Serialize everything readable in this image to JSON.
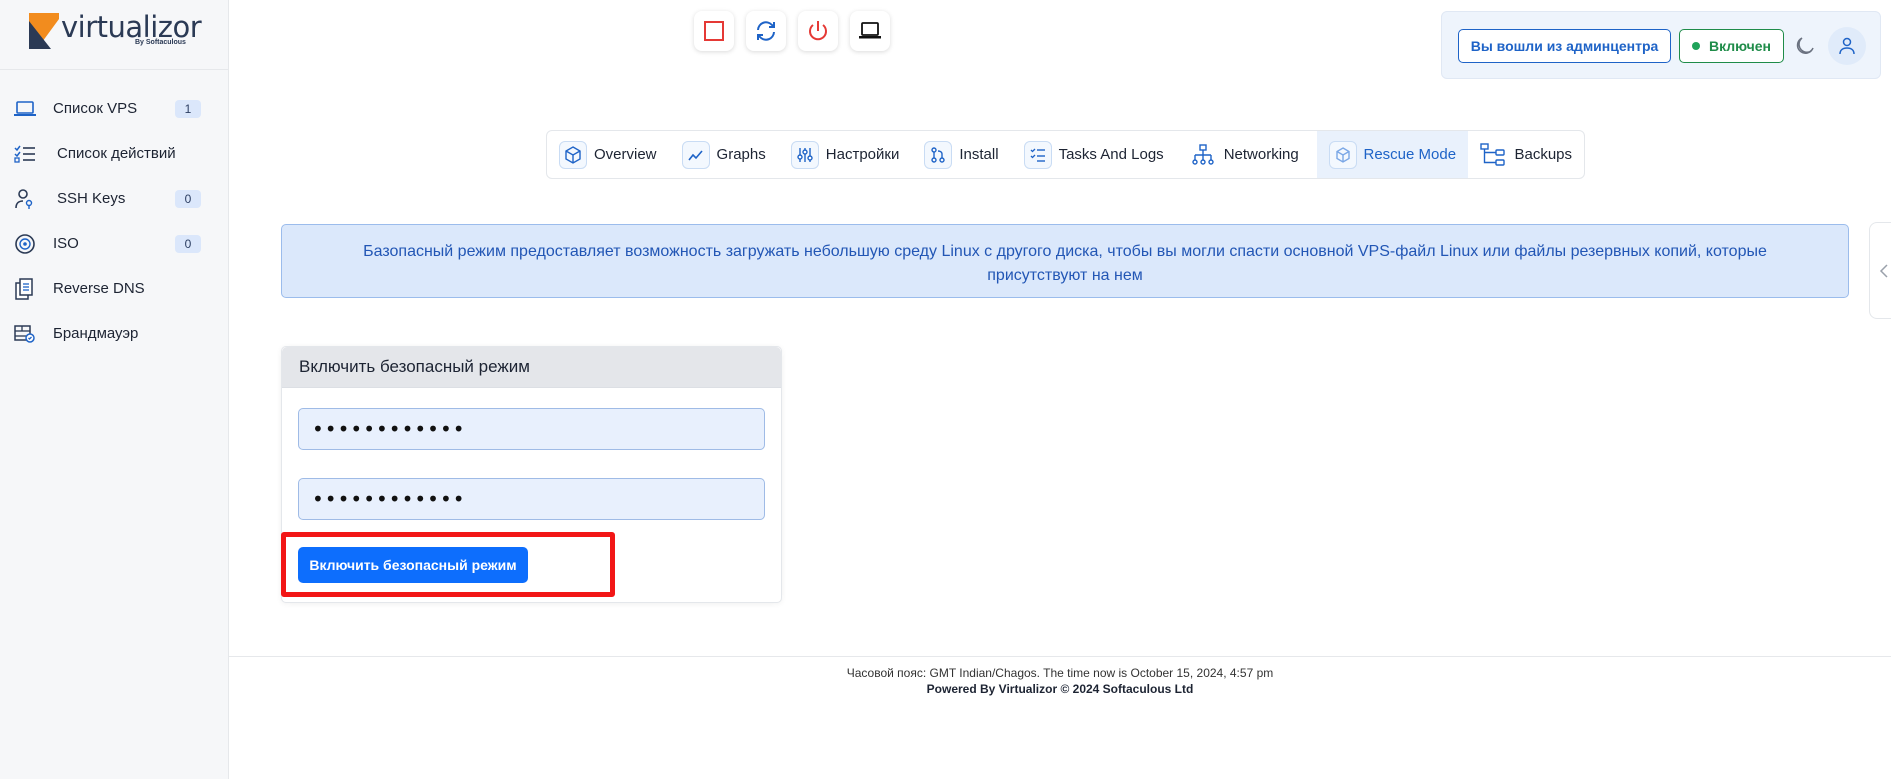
{
  "brand": {
    "name": "virtualizor",
    "by": "By Softaculous"
  },
  "sidebar": {
    "items": [
      {
        "label": "Список VPS",
        "icon": "laptop-icon",
        "badge": "1"
      },
      {
        "label": "Список действий",
        "icon": "task-list-icon",
        "badge": ""
      },
      {
        "label": "SSH Keys",
        "icon": "user-key-icon",
        "badge": "0"
      },
      {
        "label": "ISO",
        "icon": "disc-icon",
        "badge": "0"
      },
      {
        "label": "Reverse DNS",
        "icon": "documents-icon",
        "badge": ""
      },
      {
        "label": "Брандмауэр",
        "icon": "firewall-icon",
        "badge": ""
      }
    ]
  },
  "toolbar": {
    "controls": [
      "stop-icon",
      "restart-icon",
      "power-icon",
      "console-icon"
    ],
    "admin_label": "Вы вошли из админцентра",
    "status_label": "Включен"
  },
  "tabs": [
    {
      "label": "Overview",
      "icon": "cube-icon",
      "active": false
    },
    {
      "label": "Graphs",
      "icon": "chart-line-icon",
      "active": false
    },
    {
      "label": "Настройки",
      "icon": "sliders-icon",
      "active": false
    },
    {
      "label": "Install",
      "icon": "git-icon",
      "active": false
    },
    {
      "label": "Tasks And Logs",
      "icon": "checklist-icon",
      "active": false
    },
    {
      "label": "Networking",
      "icon": "network-icon",
      "active": false
    },
    {
      "label": "Rescue Mode",
      "icon": "rescue-cube-icon",
      "active": true
    },
    {
      "label": "Backups",
      "icon": "backup-tree-icon",
      "active": false
    }
  ],
  "alert": {
    "text": "Базопасный режим предоставляет возможность загружать небольшую среду Linux с другого диска, чтобы вы могли спасти основной VPS-файл Linux или файлы резервных копий, которые присутствуют на нем"
  },
  "rescue_form": {
    "title": "Включить безопасный режим",
    "password_value": "••••••••••••",
    "confirm_password_value": "••••••••••••",
    "submit_label": "Включить безопасный режим"
  },
  "footer": {
    "timezone_text": "Часовой пояс: GMT Indian/Chagos. The time now is October 15, 2024, 4:57 pm",
    "powered_text": "Powered By Virtualizor © 2024 Softaculous Ltd"
  },
  "colors": {
    "primary": "#0d6efd",
    "accent_blue": "#1e63c7",
    "status_green": "#1f8c49",
    "danger_red": "#e53935",
    "highlight_red": "#f21616"
  }
}
